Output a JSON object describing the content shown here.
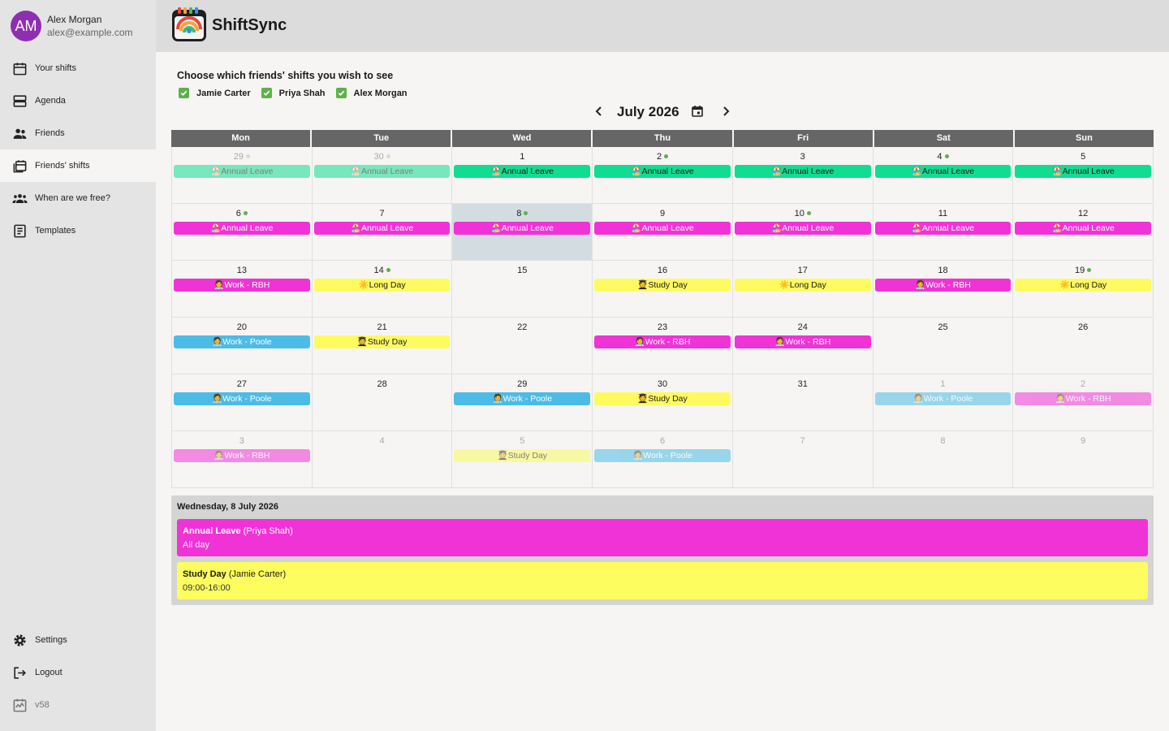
{
  "app": {
    "name": "ShiftSync"
  },
  "user": {
    "initials": "AM",
    "name": "Alex Morgan",
    "email": "alex@example.com"
  },
  "nav": {
    "items": [
      {
        "label": "Your shifts",
        "icon": "calendar-icon"
      },
      {
        "label": "Agenda",
        "icon": "agenda-icon"
      },
      {
        "label": "Friends",
        "icon": "friends-icon"
      },
      {
        "label": "Friends' shifts",
        "icon": "friends-calendar-icon"
      },
      {
        "label": "When are we free?",
        "icon": "group-icon"
      },
      {
        "label": "Templates",
        "icon": "templates-icon"
      }
    ],
    "bottom": [
      {
        "label": "Settings",
        "icon": "gear-icon"
      },
      {
        "label": "Logout",
        "icon": "logout-icon"
      },
      {
        "label": "v58",
        "icon": "version-icon"
      }
    ]
  },
  "friends_filter": {
    "title": "Choose which friends' shifts you wish to see",
    "friends": [
      {
        "name": "Jamie Carter",
        "checked": true
      },
      {
        "name": "Priya Shah",
        "checked": true
      },
      {
        "name": "Alex Morgan",
        "checked": true
      }
    ]
  },
  "calendar": {
    "month_label": "July 2026",
    "weekdays": [
      "Mon",
      "Tue",
      "Wed",
      "Thu",
      "Fri",
      "Sat",
      "Sun"
    ],
    "colors": {
      "green": "#10dd91",
      "magenta": "#f033d6",
      "yellow": "#fdfb60",
      "blue": "#4cbce6"
    },
    "weeks": [
      [
        {
          "day": "29",
          "out": true,
          "dot": true,
          "event": {
            "emoji": "🏖️",
            "label": "Annual Leave",
            "color": "green"
          }
        },
        {
          "day": "30",
          "out": true,
          "dot": true,
          "event": {
            "emoji": "🏖️",
            "label": "Annual Leave",
            "color": "green"
          }
        },
        {
          "day": "1",
          "event": {
            "emoji": "🏖️",
            "label": "Annual Leave",
            "color": "green"
          }
        },
        {
          "day": "2",
          "dot": true,
          "event": {
            "emoji": "🏖️",
            "label": "Annual Leave",
            "color": "green"
          }
        },
        {
          "day": "3",
          "event": {
            "emoji": "🏖️",
            "label": "Annual Leave",
            "color": "green"
          }
        },
        {
          "day": "4",
          "dot": true,
          "event": {
            "emoji": "🏖️",
            "label": "Annual Leave",
            "color": "green"
          }
        },
        {
          "day": "5",
          "event": {
            "emoji": "🏖️",
            "label": "Annual Leave",
            "color": "green"
          }
        }
      ],
      [
        {
          "day": "6",
          "dot": true,
          "event": {
            "emoji": "🏖️",
            "label": "Annual Leave",
            "color": "magenta"
          }
        },
        {
          "day": "7",
          "event": {
            "emoji": "🏖️",
            "label": "Annual Leave",
            "color": "magenta"
          }
        },
        {
          "day": "8",
          "dot": true,
          "selected": true,
          "event": {
            "emoji": "🏖️",
            "label": "Annual Leave",
            "color": "magenta"
          }
        },
        {
          "day": "9",
          "event": {
            "emoji": "🏖️",
            "label": "Annual Leave",
            "color": "magenta"
          }
        },
        {
          "day": "10",
          "dot": true,
          "event": {
            "emoji": "🏖️",
            "label": "Annual Leave",
            "color": "magenta"
          }
        },
        {
          "day": "11",
          "event": {
            "emoji": "🏖️",
            "label": "Annual Leave",
            "color": "magenta"
          }
        },
        {
          "day": "12",
          "event": {
            "emoji": "🏖️",
            "label": "Annual Leave",
            "color": "magenta"
          }
        }
      ],
      [
        {
          "day": "13",
          "event": {
            "emoji": "🧑‍⚕️",
            "label": "Work - RBH",
            "color": "magenta"
          }
        },
        {
          "day": "14",
          "dot": true,
          "event": {
            "emoji": "☀️",
            "label": "Long Day",
            "color": "yellow"
          }
        },
        {
          "day": "15"
        },
        {
          "day": "16",
          "event": {
            "emoji": "🧑‍🎓",
            "label": "Study Day",
            "color": "yellow"
          }
        },
        {
          "day": "17",
          "event": {
            "emoji": "☀️",
            "label": "Long Day",
            "color": "yellow"
          }
        },
        {
          "day": "18",
          "event": {
            "emoji": "🧑‍⚕️",
            "label": "Work - RBH",
            "color": "magenta"
          }
        },
        {
          "day": "19",
          "dot": true,
          "event": {
            "emoji": "☀️",
            "label": "Long Day",
            "color": "yellow"
          }
        }
      ],
      [
        {
          "day": "20",
          "event": {
            "emoji": "🧑‍⚕️",
            "label": "Work - Poole",
            "color": "blue"
          }
        },
        {
          "day": "21",
          "event": {
            "emoji": "🧑‍🎓",
            "label": "Study Day",
            "color": "yellow"
          }
        },
        {
          "day": "22"
        },
        {
          "day": "23",
          "event": {
            "emoji": "🧑‍⚕️",
            "label": "Work - RBH",
            "color": "magenta"
          }
        },
        {
          "day": "24",
          "event": {
            "emoji": "🧑‍⚕️",
            "label": "Work - RBH",
            "color": "magenta"
          }
        },
        {
          "day": "25"
        },
        {
          "day": "26"
        }
      ],
      [
        {
          "day": "27",
          "event": {
            "emoji": "🧑‍⚕️",
            "label": "Work - Poole",
            "color": "blue"
          }
        },
        {
          "day": "28"
        },
        {
          "day": "29",
          "event": {
            "emoji": "🧑‍⚕️",
            "label": "Work - Poole",
            "color": "blue"
          }
        },
        {
          "day": "30",
          "event": {
            "emoji": "🧑‍🎓",
            "label": "Study Day",
            "color": "yellow"
          }
        },
        {
          "day": "31"
        },
        {
          "day": "1",
          "out": true,
          "event": {
            "emoji": "🧑‍⚕️",
            "label": "Work - Poole",
            "color": "blue"
          }
        },
        {
          "day": "2",
          "out": true,
          "event": {
            "emoji": "🧑‍⚕️",
            "label": "Work - RBH",
            "color": "magenta"
          }
        }
      ],
      [
        {
          "day": "3",
          "out": true,
          "event": {
            "emoji": "🧑‍⚕️",
            "label": "Work - RBH",
            "color": "magenta"
          }
        },
        {
          "day": "4",
          "out": true
        },
        {
          "day": "5",
          "out": true,
          "event": {
            "emoji": "🧑‍🎓",
            "label": "Study Day",
            "color": "yellow"
          }
        },
        {
          "day": "6",
          "out": true,
          "event": {
            "emoji": "🧑‍⚕️",
            "label": "Work - Poole",
            "color": "blue"
          }
        },
        {
          "day": "7",
          "out": true
        },
        {
          "day": "8",
          "out": true
        },
        {
          "day": "9",
          "out": true
        }
      ]
    ]
  },
  "day_detail": {
    "date": "Wednesday, 8 July 2026",
    "items": [
      {
        "title": "Annual Leave",
        "person": "(Priya Shah)",
        "time": "All day",
        "color": "#f033d6",
        "text_color": "#ffffff",
        "sub_color": "#fde0f7"
      },
      {
        "title": "Study Day",
        "person": "(Jamie Carter)",
        "time": "09:00-16:00",
        "color": "#fdfd60",
        "text_color": "#1a1a1a",
        "sub_color": "#333333"
      }
    ]
  }
}
